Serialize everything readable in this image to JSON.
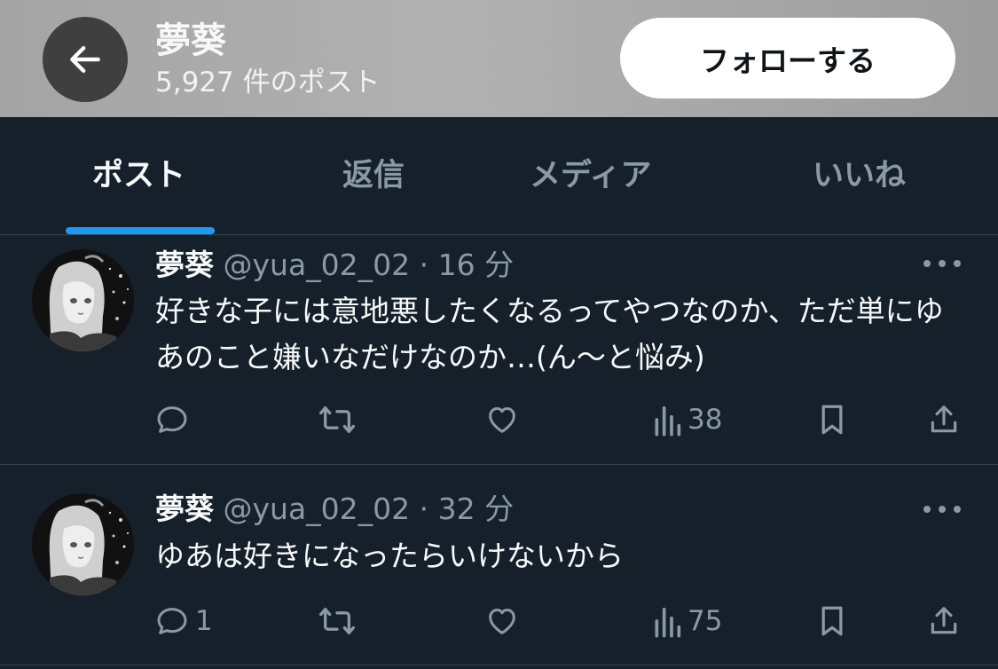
{
  "header": {
    "name": "夢葵",
    "post_count": "5,927 件のポスト",
    "follow_label": "フォローする"
  },
  "tabs": [
    {
      "label": "ポスト",
      "active": true
    },
    {
      "label": "返信",
      "active": false
    },
    {
      "label": "メディア",
      "active": false
    },
    {
      "label": "いいね",
      "active": false
    }
  ],
  "tweets": [
    {
      "name": "夢葵",
      "handle": "@yua_02_02",
      "time": "16 分",
      "text": "好きな子には意地悪したくなるってやつなのか、ただ単にゆあのこと嫌いなだけなのか…(ん〜と悩み)",
      "replies": "",
      "views": "38"
    },
    {
      "name": "夢葵",
      "handle": "@yua_02_02",
      "time": "32 分",
      "text": "ゆあは好きになったらいけないから",
      "replies": "1",
      "views": "75"
    }
  ],
  "colors": {
    "background": "#15202b",
    "accent": "#1d9bf0",
    "secondary_text": "#8b98a5",
    "divider": "#38444d"
  },
  "icons": [
    "back-arrow-icon",
    "more-icon",
    "reply-icon",
    "retweet-icon",
    "like-icon",
    "views-icon",
    "bookmark-icon",
    "share-icon"
  ]
}
